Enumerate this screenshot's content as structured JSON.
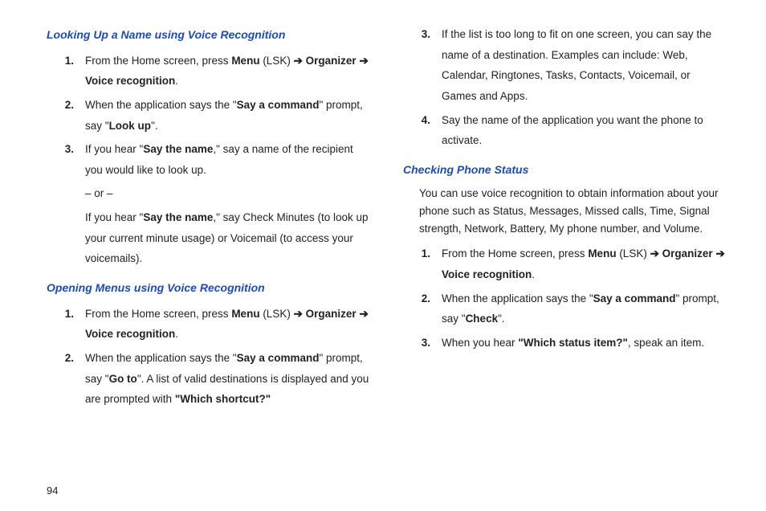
{
  "leftColumn": {
    "heading1": "Looking Up a Name using Voice Recognition",
    "item1": {
      "num": "1.",
      "parts": [
        "From the Home screen, press ",
        "Menu",
        " (LSK) ",
        "➔",
        " ",
        "Organizer",
        " ",
        "➔",
        " ",
        "Voice recognition",
        "."
      ]
    },
    "item2": {
      "num": "2.",
      "parts": [
        "When the application says the \"",
        "Say a command",
        "\" prompt, say \"",
        "Look up",
        "\"."
      ]
    },
    "item3": {
      "num": "3.",
      "partsA": [
        "If you hear \"",
        "Say the name",
        ",\" say a name of the recipient you would like to look up."
      ],
      "or": "– or –",
      "partsB": [
        "If you hear \"",
        "Say the name",
        ",\" say Check Minutes (to look up your current minute usage) or Voicemail (to access your voicemails)."
      ]
    },
    "heading2": "Opening Menus using Voice Recognition",
    "item4": {
      "num": "1.",
      "parts": [
        "From the Home screen, press ",
        "Menu",
        " (LSK) ",
        "➔",
        " ",
        "Organizer",
        " ",
        "➔",
        " ",
        "Voice recognition",
        "."
      ]
    },
    "item5": {
      "num": "2.",
      "parts": [
        "When the application says the \"",
        "Say a command",
        "\" prompt, say \"",
        "Go to",
        "\". A list of valid destinations is displayed and you are prompted with ",
        "\"Which shortcut?\""
      ]
    }
  },
  "rightColumn": {
    "item6": {
      "num": "3.",
      "text": "If the list is too long to fit on one screen, you can say the name of a destination. Examples can include: Web, Calendar, Ringtones, Tasks, Contacts, Voicemail, or Games and Apps."
    },
    "item7": {
      "num": "4.",
      "text": "Say the name of the application you want the phone to activate."
    },
    "heading3": "Checking Phone Status",
    "intro": "You can use voice recognition to obtain information about your phone such as Status, Messages, Missed calls, Time, Signal strength, Network, Battery, My phone number, and Volume.",
    "item8": {
      "num": "1.",
      "parts": [
        "From the Home screen, press ",
        "Menu",
        " (LSK) ",
        "➔",
        " ",
        "Organizer",
        " ",
        "➔",
        " ",
        "Voice recognition",
        "."
      ]
    },
    "item9": {
      "num": "2.",
      "parts": [
        "When the application says the \"",
        "Say a command",
        "\" prompt, say \"",
        "Check",
        "\"."
      ]
    },
    "item10": {
      "num": "3.",
      "parts": [
        "When you hear ",
        "\"Which status item?\"",
        ", speak an item."
      ]
    }
  },
  "pageNumber": "94"
}
